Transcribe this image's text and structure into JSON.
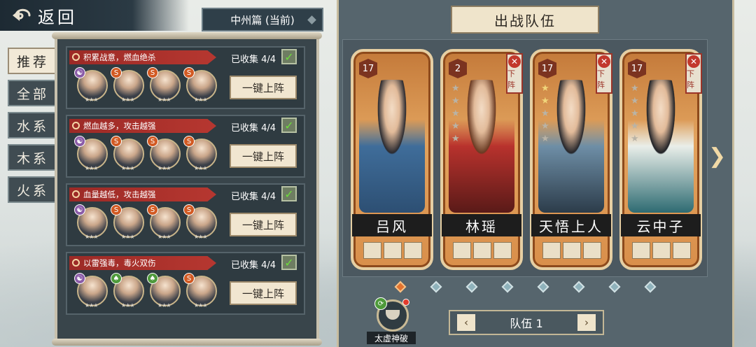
{
  "nav": {
    "back_label": "返回",
    "chapter_label": "中州篇 (当前)"
  },
  "tabs": [
    "推荐",
    "全部",
    "水系",
    "木系",
    "火系"
  ],
  "lineups": [
    {
      "tag": "积累战意，燃血绝杀",
      "collected": "已收集 4/4",
      "button": "一键上阵",
      "heroes": [
        {
          "element": "阴"
        },
        {
          "element": "火"
        },
        {
          "element": "火"
        },
        {
          "element": "火"
        }
      ]
    },
    {
      "tag": "燃血越多，攻击越强",
      "collected": "已收集 4/4",
      "button": "一键上阵",
      "heroes": [
        {
          "element": "阴"
        },
        {
          "element": "火"
        },
        {
          "element": "火"
        },
        {
          "element": "火"
        }
      ]
    },
    {
      "tag": "血量越低，攻击越强",
      "collected": "已收集 4/4",
      "button": "一键上阵",
      "heroes": [
        {
          "element": "阴"
        },
        {
          "element": "火"
        },
        {
          "element": "火"
        },
        {
          "element": "火"
        }
      ]
    },
    {
      "tag": "以雷强毒，毒火双伤",
      "collected": "已收集 4/4",
      "button": "一键上阵",
      "heroes": [
        {
          "element": "阴"
        },
        {
          "element": "木"
        },
        {
          "element": "木"
        },
        {
          "element": "火"
        }
      ]
    }
  ],
  "panel": {
    "title": "出战队伍"
  },
  "team_slots": [
    {
      "level": "17",
      "name": "吕风",
      "stars_filled": 0,
      "stars_total": 0,
      "has_remove": false,
      "remove_label": "下阵"
    },
    {
      "level": "2",
      "name": "林瑶",
      "stars_filled": 0,
      "stars_total": 5,
      "has_remove": true,
      "remove_label": "下阵"
    },
    {
      "level": "17",
      "name": "天悟上人",
      "stars_filled": 2,
      "stars_total": 5,
      "has_remove": true,
      "remove_label": "下阵"
    },
    {
      "level": "17",
      "name": "云中子",
      "stars_filled": 0,
      "stars_total": 5,
      "has_remove": true,
      "remove_label": "下阵"
    }
  ],
  "pager": {
    "count": 8,
    "active": 0
  },
  "skill": {
    "label": "太虚神破"
  },
  "team_selector": {
    "label": "队伍 1",
    "prev": "‹",
    "next": "›"
  },
  "colors": {
    "accent": "#e3732f",
    "panel": "#56656d",
    "tag_red": "#b63730"
  },
  "icons": {
    "back": "swirl-back-icon",
    "collected": "check-icon",
    "next_page": "chevron-right-icon"
  }
}
